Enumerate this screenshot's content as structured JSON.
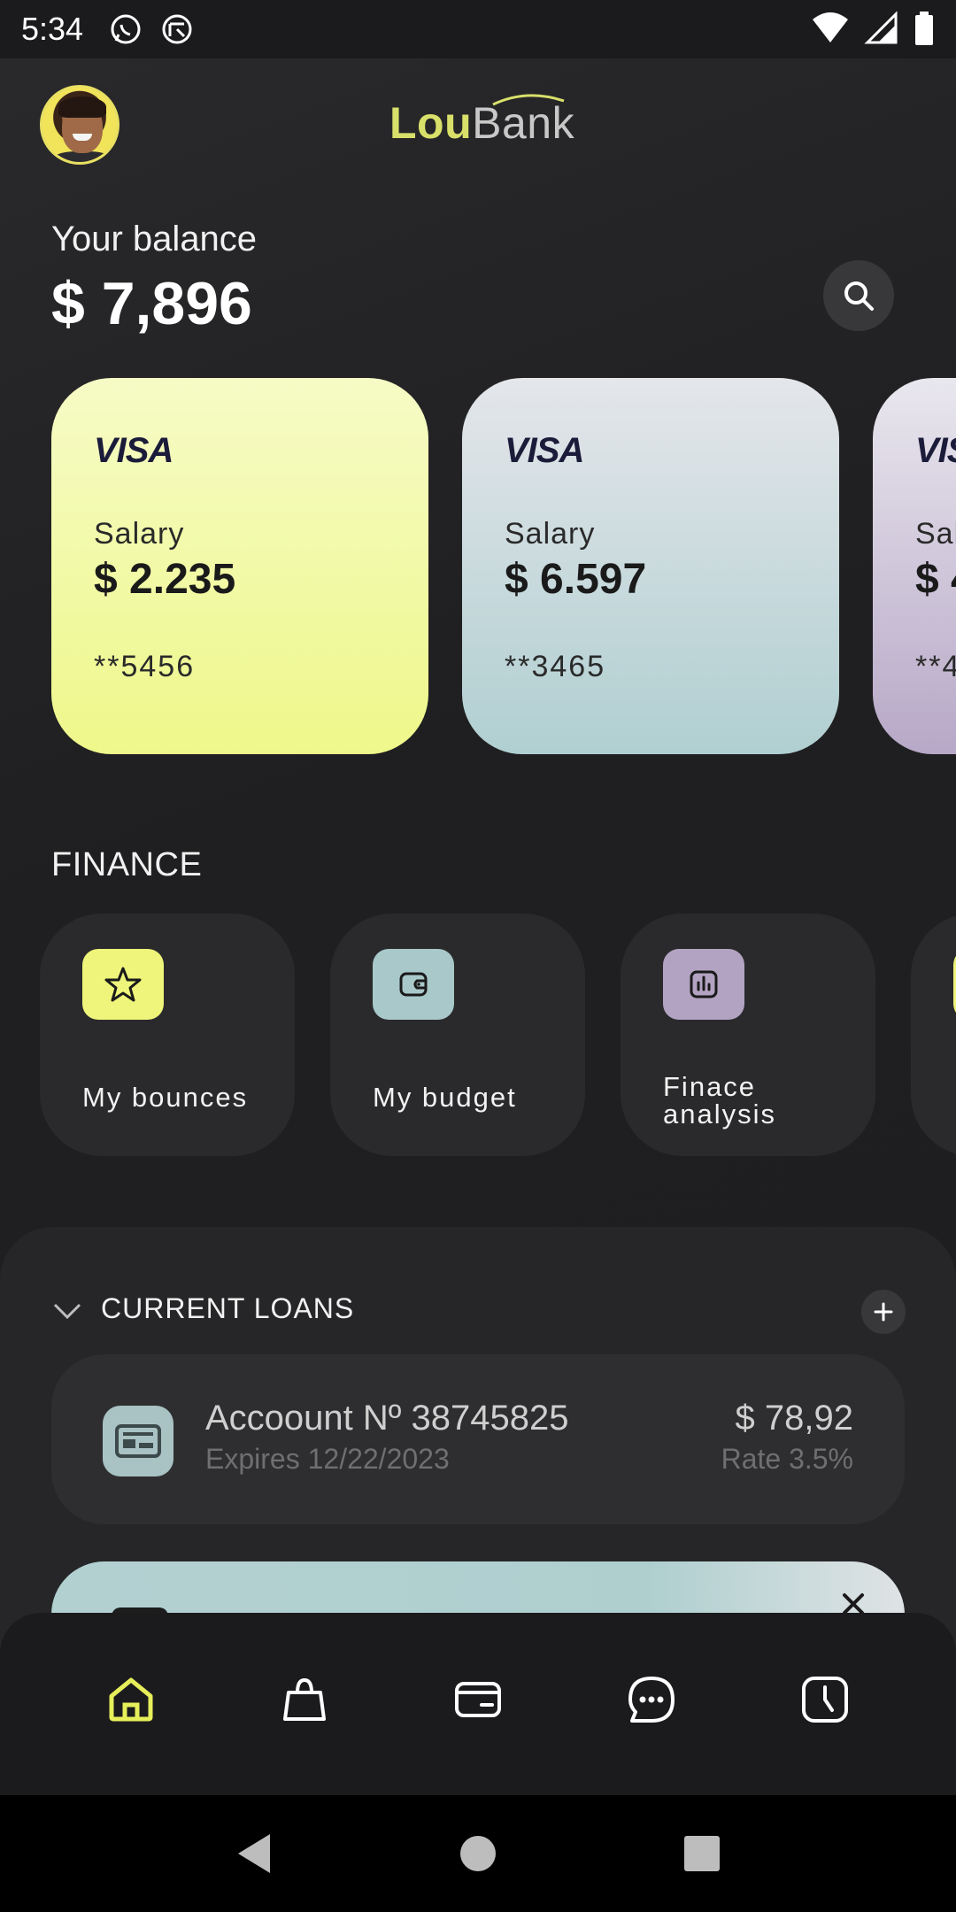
{
  "status_bar": {
    "time": "5:34"
  },
  "header": {
    "logo_part1": "Lou",
    "logo_part2": "Bank"
  },
  "balance": {
    "label": "Your balance",
    "value": "$ 7,896"
  },
  "cards": [
    {
      "brand": "VISA",
      "type": "Salary",
      "amount": "$ 2.235",
      "number": "**5456"
    },
    {
      "brand": "VISA",
      "type": "Salary",
      "amount": "$ 6.597",
      "number": "**3465"
    },
    {
      "brand": "VISA",
      "type": "Salary",
      "amount": "$ 4",
      "number": "**4"
    }
  ],
  "finance": {
    "title": "FINANCE",
    "tiles": [
      {
        "label": "My bounces",
        "icon": "star-icon",
        "color": "#eef57a"
      },
      {
        "label": "My budget",
        "icon": "wallet-icon",
        "color": "#a9c8c9"
      },
      {
        "label": "Finace analysis",
        "icon": "chart-icon",
        "color": "#b3a3c2"
      },
      {
        "label": "",
        "icon": "unknown-icon",
        "color": "#eef57a"
      }
    ]
  },
  "loans": {
    "title": "CURRENT LOANS",
    "items": [
      {
        "name": "Accoount Nº 38745825",
        "expires": "Expires 12/22/2023",
        "amount": "$ 78,92",
        "rate": "Rate 3.5%"
      }
    ]
  },
  "nav": [
    "home-icon",
    "bag-icon",
    "card-icon",
    "chat-icon",
    "clock-icon"
  ],
  "colors": {
    "accent": "#e6ee5a",
    "background": "#1f1f21"
  }
}
